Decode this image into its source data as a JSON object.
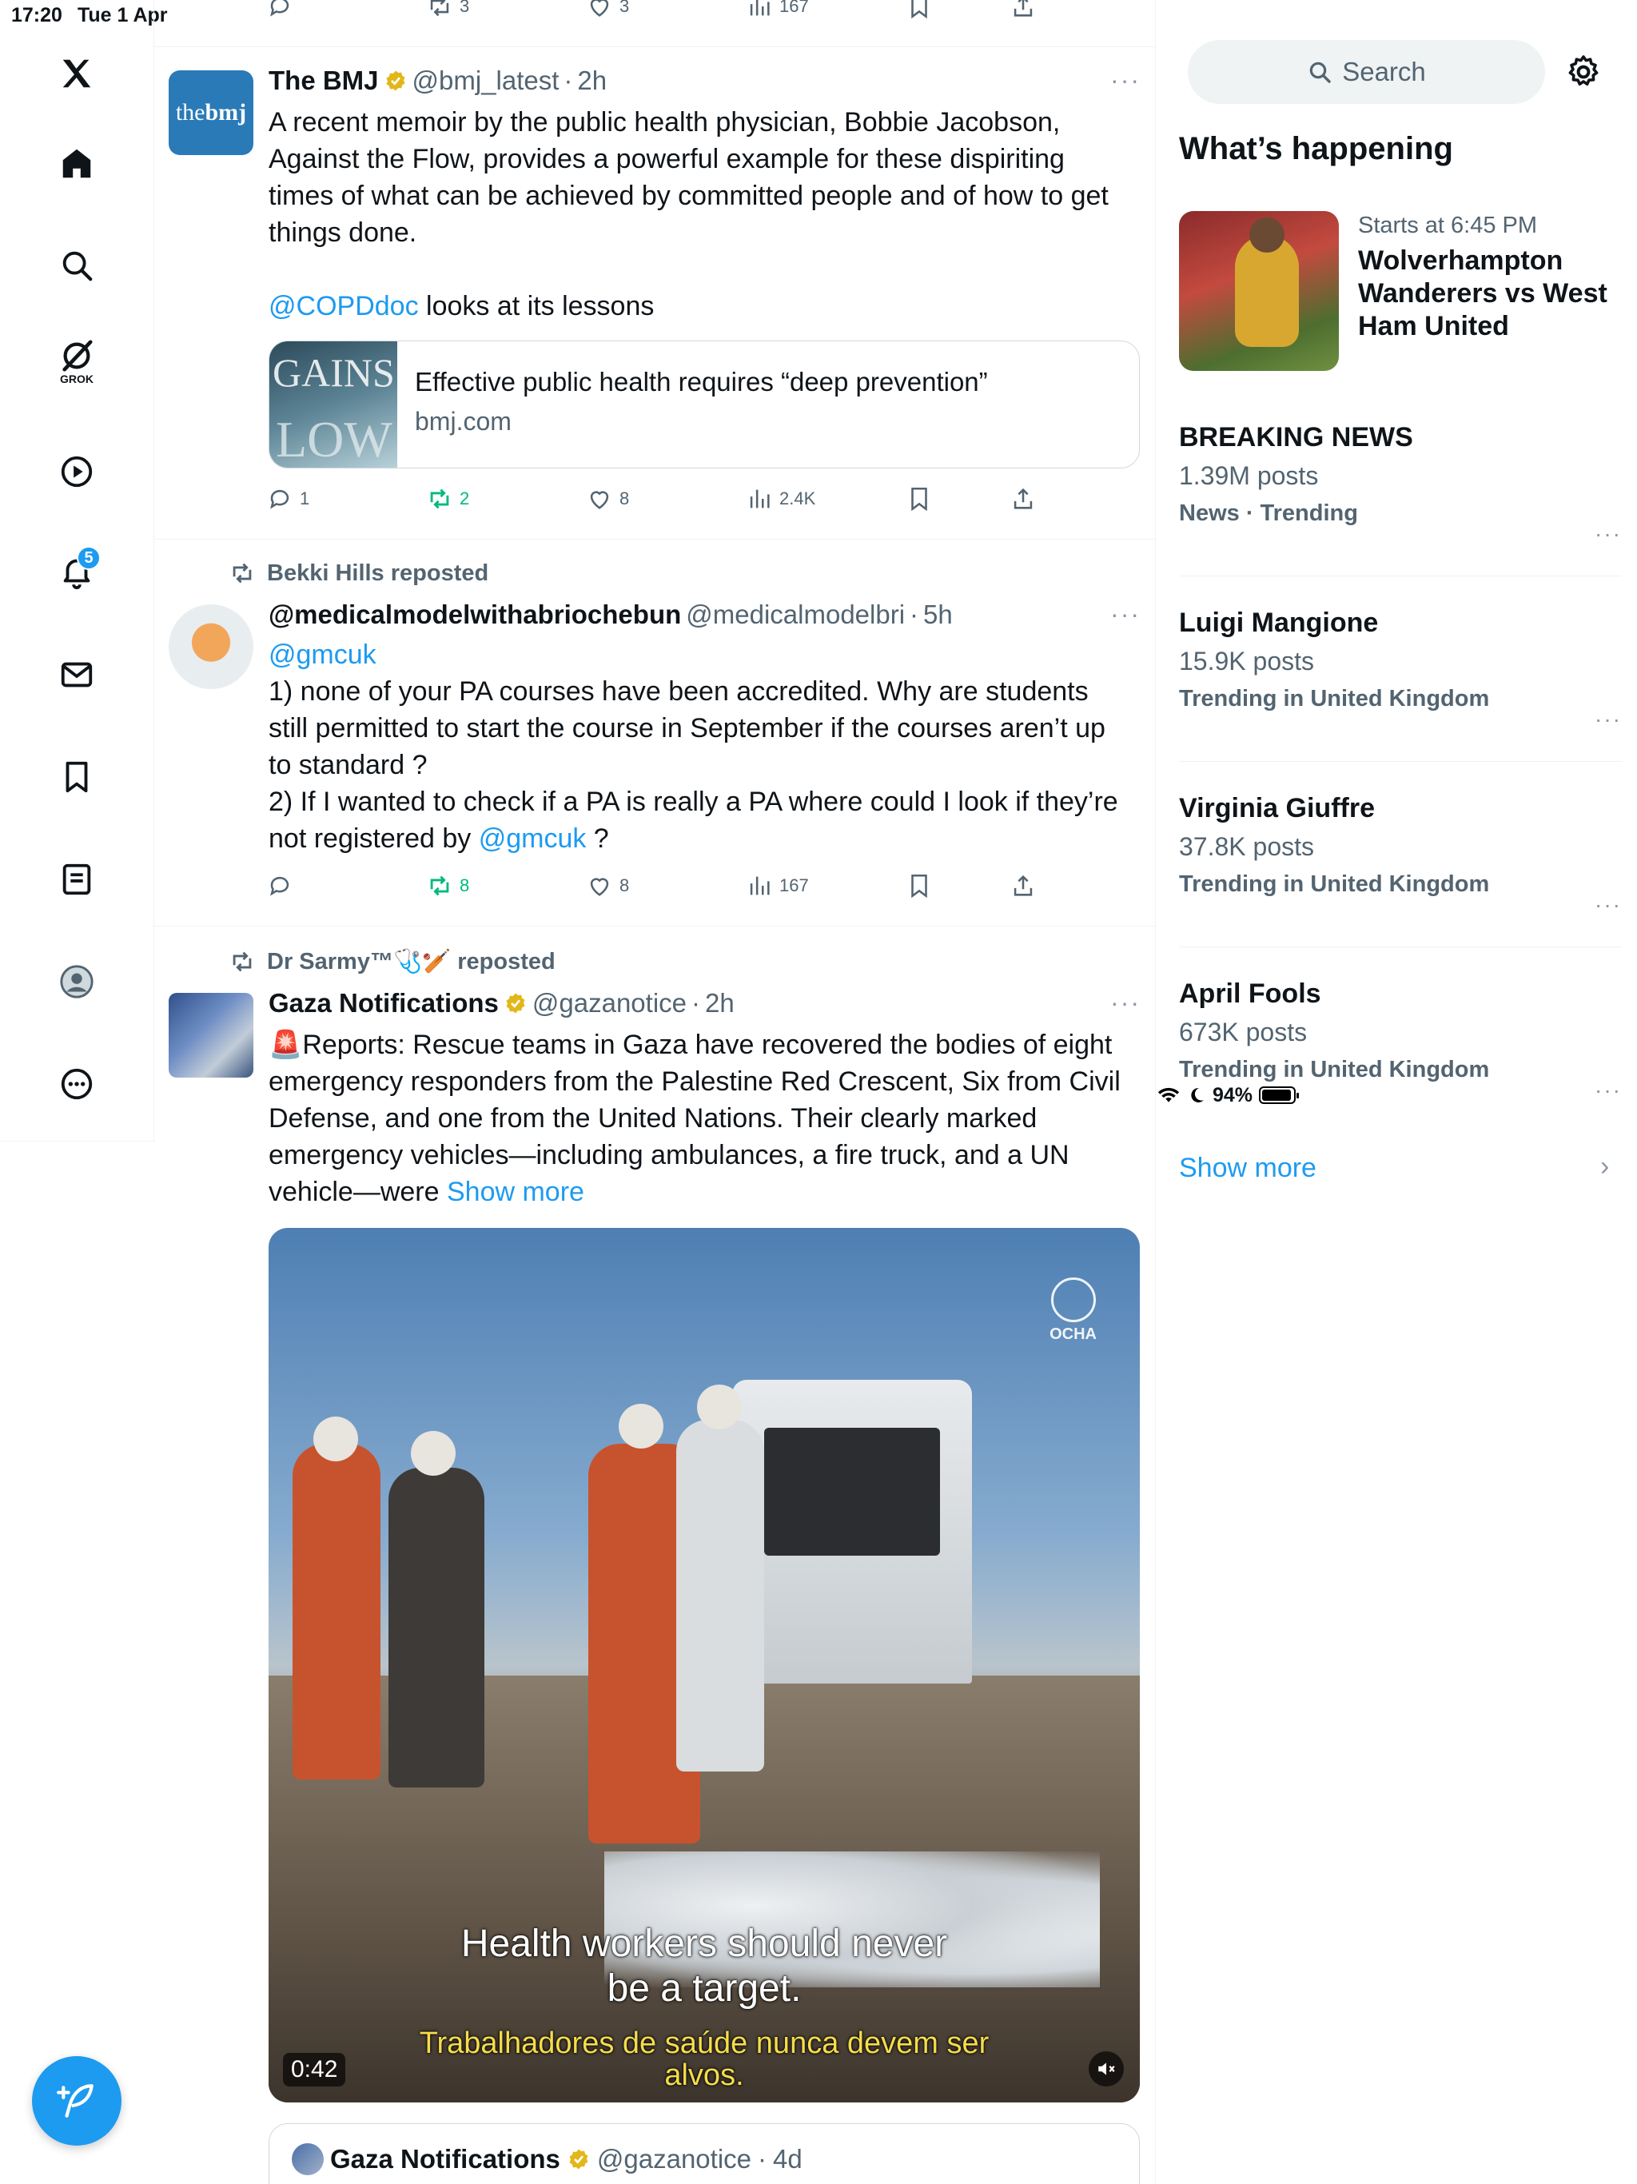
{
  "status_bar": {
    "time": "17:20",
    "date": "Tue 1 Apr",
    "battery": "94%"
  },
  "nav": {
    "items": [
      "Home",
      "Explore",
      "Grok",
      "Video",
      "Notifications",
      "Messages",
      "Bookmarks",
      "Lists",
      "Profile",
      "More"
    ],
    "grok_label": "GROK",
    "notifications_badge": "5"
  },
  "top_partial_actions": {
    "reply": "",
    "repost": "3",
    "like": "3",
    "views": "167"
  },
  "tweets": [
    {
      "name": "The BMJ",
      "handle": "@bmj_latest",
      "time": "2h",
      "avatar_text_a": "the",
      "avatar_text_b": "bmj",
      "text": "A recent memoir by the public health physician, Bobbie Jacobson, Against the Flow, provides a powerful example for these dispiriting times of what can be achieved by committed people and of how to get things done.",
      "mention": "@COPDdoc",
      "text2": " looks at its lessons",
      "card": {
        "title": "Effective public health requires “deep prevention”",
        "domain": "bmj.com",
        "image_text_1": "GAINS",
        "image_text_2": "LOW"
      },
      "stats": {
        "reply": "1",
        "repost": "2",
        "like": "8",
        "views": "2.4K"
      }
    },
    {
      "reposted_by": "Bekki Hills reposted",
      "name": "@medicalmodelwithabriochebun",
      "handle": "@medicalmodelbri",
      "time": "5h",
      "mention": "@gmcuk",
      "line1": "1) none of your PA courses have been accredited. Why are students still permitted to start the course in September if the courses aren’t up to standard ?",
      "line2a": "2) If I wanted to check if a PA is really a PA where could I look if they’re not registered by ",
      "line2b": " ?",
      "stats": {
        "reply": "",
        "repost": "8",
        "like": "8",
        "views": "167"
      }
    },
    {
      "reposted_by": "Dr Sarmy™🩺🏏 reposted",
      "name": "Gaza Notifications",
      "handle": "@gazanotice",
      "time": "2h",
      "text": "🚨Reports: Rescue teams in Gaza have recovered the bodies of eight emergency responders from the Palestine Red Crescent, Six from Civil Defense, and one from the United Nations. Their clearly marked emergency vehicles—including ambulances, a fire truck, and a UN vehicle—were ",
      "show_more": "Show more",
      "video": {
        "logo": "OCHA",
        "subtitle_en": "Health workers should never be a target.",
        "subtitle_pt": "Trabalhadores de saúde nunca devem ser alvos.",
        "duration": "0:42"
      },
      "quote": {
        "name": "Gaza Notifications",
        "handle": "@gazanotice",
        "time": "4d"
      }
    }
  ],
  "sidebar": {
    "search_placeholder": "Search",
    "section_title": "What’s happening",
    "event": {
      "meta": "Starts at 6:45 PM",
      "title": "Wolverhampton Wanderers vs West Ham United"
    },
    "trends": [
      {
        "name": "BREAKING NEWS",
        "count": "1.39M posts",
        "context": "News · Trending"
      },
      {
        "name": "Luigi Mangione",
        "count": "15.9K posts",
        "context": "Trending in United Kingdom"
      },
      {
        "name": "Virginia Giuffre",
        "count": "37.8K posts",
        "context": "Trending in United Kingdom"
      },
      {
        "name": "April Fools",
        "count": "673K posts",
        "context": "Trending in United Kingdom"
      }
    ],
    "show_more": "Show more"
  },
  "colors": {
    "accent": "#1d9bf0",
    "repost_green": "#00ba7c",
    "muted": "#536471",
    "verified_gold": "#e2b719"
  }
}
